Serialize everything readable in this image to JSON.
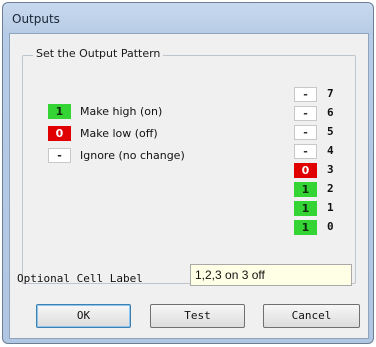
{
  "window": {
    "title": "Outputs"
  },
  "group": {
    "legend": "Set the Output Pattern"
  },
  "key": [
    {
      "symbol": "1",
      "label": "Make high (on)",
      "state": "high"
    },
    {
      "symbol": "0",
      "label": "Make low (off)",
      "state": "low"
    },
    {
      "symbol": "-",
      "label": "Ignore (no change)",
      "state": "ignore"
    }
  ],
  "bits": [
    {
      "num": "7",
      "value": "-",
      "state": "ignore"
    },
    {
      "num": "6",
      "value": "-",
      "state": "ignore"
    },
    {
      "num": "5",
      "value": "-",
      "state": "ignore"
    },
    {
      "num": "4",
      "value": "-",
      "state": "ignore"
    },
    {
      "num": "3",
      "value": "0",
      "state": "low"
    },
    {
      "num": "2",
      "value": "1",
      "state": "high"
    },
    {
      "num": "1",
      "value": "1",
      "state": "high"
    },
    {
      "num": "0",
      "value": "1",
      "state": "high"
    }
  ],
  "cell_label": {
    "label": "Optional Cell Label",
    "value": "1,2,3 on 3 off"
  },
  "buttons": {
    "ok": "OK",
    "test": "Test",
    "cancel": "Cancel"
  },
  "colors": {
    "high": "#33d433",
    "low": "#e00000",
    "input_bg": "#ffffe6"
  }
}
